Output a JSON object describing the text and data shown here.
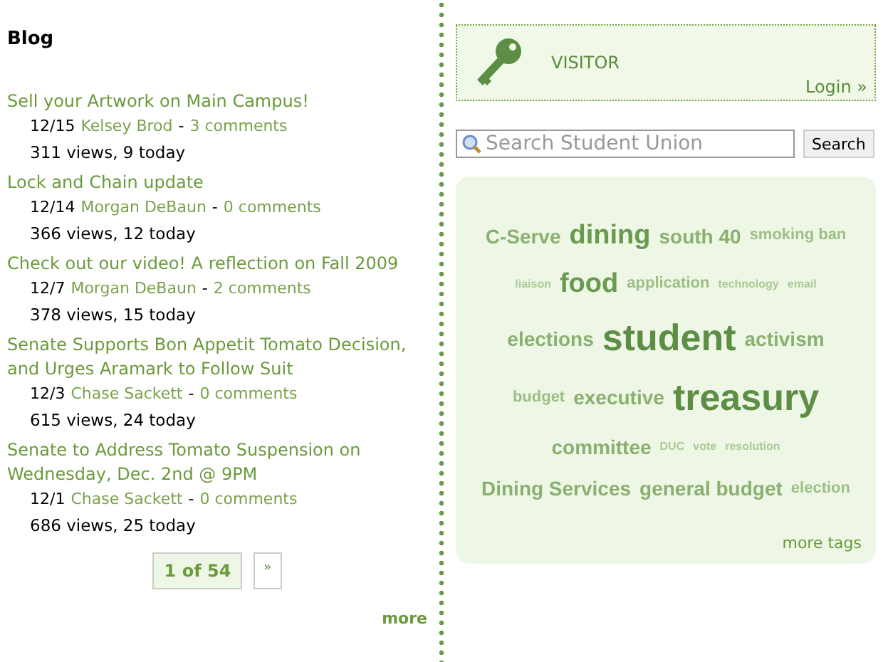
{
  "blog": {
    "title": "Blog",
    "posts": [
      {
        "title": "Sell your Artwork on Main Campus!",
        "date": "12/15",
        "author": "Kelsey Brod",
        "separator": "-",
        "comments": "3 comments",
        "views": "311 views, 9 today"
      },
      {
        "title": "Lock and Chain update",
        "date": "12/14",
        "author": "Morgan DeBaun",
        "separator": "-",
        "comments": "0 comments",
        "views": "366 views, 12 today"
      },
      {
        "title": "Check out our video! A reflection on Fall 2009",
        "date": "12/7",
        "author": "Morgan DeBaun",
        "separator": "-",
        "comments": "2 comments",
        "views": "378 views, 15 today"
      },
      {
        "title": "Senate Supports Bon Appetit Tomato Decision, and Urges Aramark to Follow Suit",
        "date": "12/3",
        "author": "Chase Sackett",
        "separator": "-",
        "comments": "0 comments",
        "views": "615 views, 24 today"
      },
      {
        "title": "Senate to Address Tomato Suspension on Wednesday, Dec. 2nd @ 9PM",
        "date": "12/1",
        "author": "Chase Sackett",
        "separator": "-",
        "comments": "0 comments",
        "views": "686 views, 25 today"
      }
    ],
    "pager": {
      "current": "1 of 54",
      "next": "»"
    },
    "more": "more"
  },
  "login": {
    "role": "VISITOR",
    "link": "Login »"
  },
  "search": {
    "placeholder": "Search Student Union",
    "button": "Search"
  },
  "tags": {
    "items": [
      {
        "text": "C-Serve",
        "kind": "medium"
      },
      {
        "text": "dining",
        "kind": "large"
      },
      {
        "text": "south 40",
        "kind": "medium"
      },
      {
        "text": "smoking ban",
        "kind": "small"
      },
      {
        "text": "liaison",
        "kind": "tiny"
      },
      {
        "text": "food",
        "kind": "large"
      },
      {
        "text": "application",
        "kind": "small"
      },
      {
        "text": "technology",
        "kind": "tiny"
      },
      {
        "text": "email",
        "kind": "tiny"
      },
      {
        "text": "elections",
        "kind": "medium"
      },
      {
        "text": "student",
        "kind": "huge"
      },
      {
        "text": "activism",
        "kind": "medium"
      },
      {
        "text": "budget",
        "kind": "small"
      },
      {
        "text": "executive",
        "kind": "medium"
      },
      {
        "text": "treasury",
        "kind": "huge"
      },
      {
        "text": "committee",
        "kind": "medium"
      },
      {
        "text": "DUC",
        "kind": "tiny"
      },
      {
        "text": "vote",
        "kind": "tiny"
      },
      {
        "text": "resolution",
        "kind": "tiny"
      },
      {
        "text": "Dining Services",
        "kind": "medium"
      },
      {
        "text": "general budget",
        "kind": "medium"
      },
      {
        "text": "election",
        "kind": "small"
      }
    ],
    "more": "more tags"
  }
}
